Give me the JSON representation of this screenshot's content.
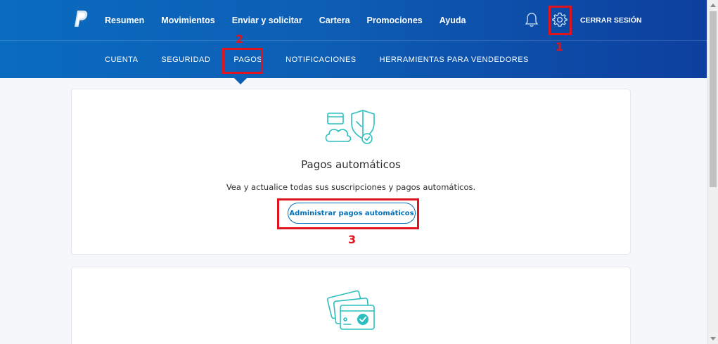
{
  "header": {
    "top_nav": [
      "Resumen",
      "Movimientos",
      "Enviar y solicitar",
      "Cartera",
      "Promociones",
      "Ayuda"
    ],
    "logout_label": "CERRAR SESIÓN",
    "sub_nav": [
      "CUENTA",
      "SEGURIDAD",
      "PAGOS",
      "NOTIFICACIONES",
      "HERRAMIENTAS PARA VENDEDORES"
    ],
    "active_sub_nav": "PAGOS",
    "icons": [
      "paypal-logo-icon",
      "bell-icon",
      "gear-icon"
    ]
  },
  "annotations": {
    "step_1": "1",
    "step_2": "2",
    "step_3": "3",
    "color": "#e0141e"
  },
  "card_automatic_payments": {
    "title": "Pagos automáticos",
    "description": "Vea y actualice todas sus suscripciones y pagos automáticos.",
    "button_label": "Administrar pagos automáticos",
    "icon": "cloud-card-shield-icon"
  },
  "card_payment_methods": {
    "icon": "cards-check-icon"
  },
  "colors": {
    "header_start": "#0a6cbf",
    "header_end": "#0d3f9e",
    "link_blue": "#0070ba",
    "icon_teal": "#2bbfbf"
  }
}
